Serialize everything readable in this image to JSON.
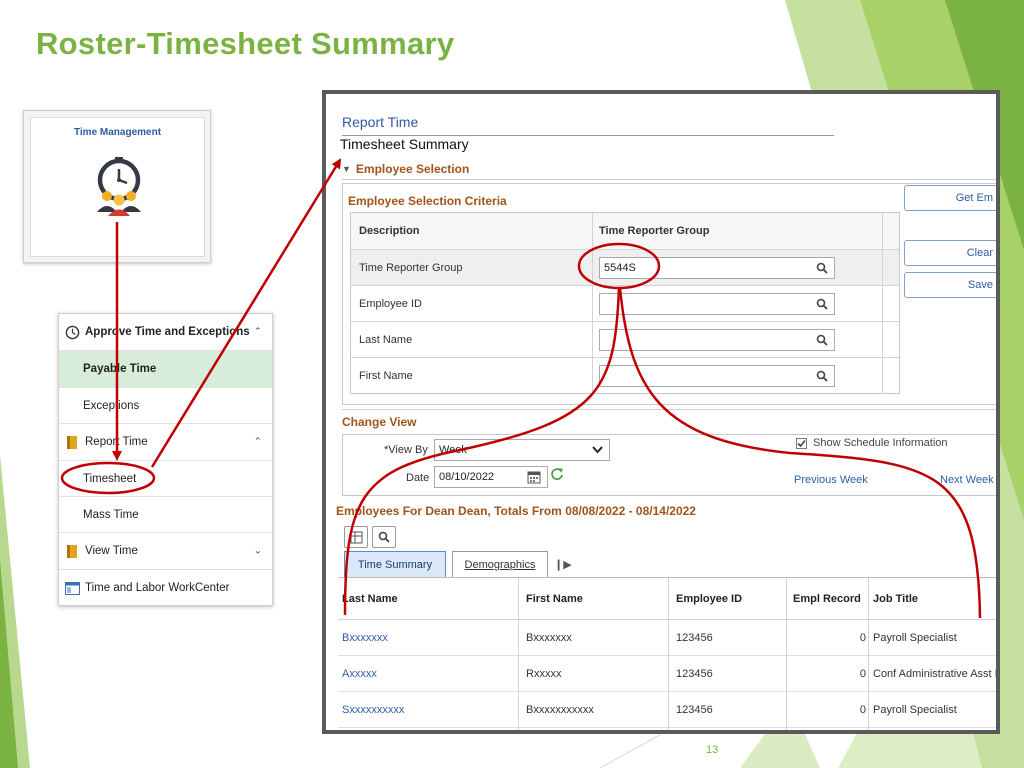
{
  "slide": {
    "title": "Roster-Timesheet Summary",
    "page_number": "13",
    "accent_color": "#7ab342",
    "highlight_color": "#c00000"
  },
  "tile": {
    "title": "Time Management",
    "icon": "clock-people-icon"
  },
  "nav": {
    "items": [
      {
        "label": "Approve Time and Exceptions",
        "icon": "clock-icon",
        "type": "header",
        "expanded": true
      },
      {
        "label": "Payable Time",
        "type": "sub",
        "selected": true
      },
      {
        "label": "Exceptions",
        "type": "sub"
      },
      {
        "label": "Report Time",
        "icon": "book-icon",
        "type": "header",
        "expanded": true
      },
      {
        "label": "Timesheet",
        "type": "sub",
        "highlighted": true
      },
      {
        "label": "Mass Time",
        "type": "sub"
      },
      {
        "label": "View Time",
        "icon": "book-icon",
        "type": "header",
        "expanded": false
      },
      {
        "label": "Time and Labor WorkCenter",
        "icon": "window-icon",
        "type": "header"
      }
    ]
  },
  "screen": {
    "breadcrumb": "Report Time",
    "page_title": "Timesheet Summary",
    "employee_selection": {
      "section_label": "Employee Selection",
      "criteria_label": "Employee Selection Criteria",
      "columns": [
        "Description",
        "Time Reporter Group"
      ],
      "rows": [
        {
          "description": "Time Reporter Group",
          "value": "5544S"
        },
        {
          "description": "Employee ID",
          "value": ""
        },
        {
          "description": "Last Name",
          "value": ""
        },
        {
          "description": "First Name",
          "value": ""
        }
      ]
    },
    "buttons": {
      "get_employees": "Get Em",
      "clear": "Clear",
      "save": "Save"
    },
    "change_view": {
      "section_label": "Change View",
      "view_by_label": "*View By",
      "view_by_value": "Week",
      "date_label": "Date",
      "date_value": "08/10/2022",
      "show_schedule_label": "Show Schedule Information",
      "show_schedule_checked": true,
      "previous_week": "Previous Week",
      "next_week": "Next Week"
    },
    "employees": {
      "heading_prefix": "Employees For ",
      "heading_name": "Dean Dean",
      "heading_suffix": ", Totals From 08/08/2022 - 08/14/2022",
      "tabs": [
        "Time Summary",
        "Demographics"
      ],
      "active_tab": 0,
      "columns": [
        "Last Name",
        "First Name",
        "Employee ID",
        "Empl Record",
        "Job Title"
      ],
      "rows": [
        {
          "last_name": "Bxxxxxxx",
          "first_name": "Bxxxxxxx",
          "employee_id": "123456",
          "empl_record": "0",
          "job_title": "Payroll Specialist"
        },
        {
          "last_name": "Axxxxx",
          "first_name": "Rxxxxx",
          "employee_id": "123456",
          "empl_record": "0",
          "job_title": "Conf Administrative Asst I"
        },
        {
          "last_name": "Sxxxxxxxxxx",
          "first_name": "Bxxxxxxxxxxx",
          "employee_id": "123456",
          "empl_record": "0",
          "job_title": "Payroll Specialist"
        }
      ]
    }
  }
}
